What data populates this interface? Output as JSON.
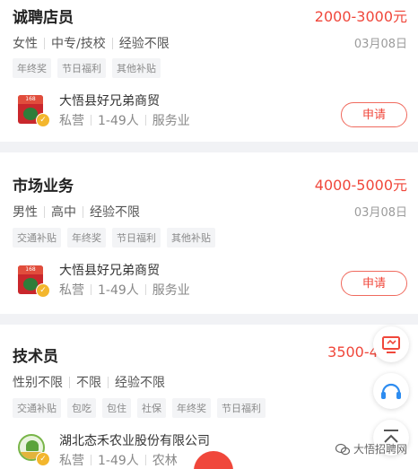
{
  "jobs": [
    {
      "title": "诚聘店员",
      "salary": "2000-3000元",
      "req": [
        "女性",
        "中专/技校",
        "经验不限"
      ],
      "date": "03月08日",
      "tags": [
        "年终奖",
        "节日福利",
        "其他补贴"
      ],
      "company": "大悟县好兄弟商贸",
      "meta": [
        "私营",
        "1-49人",
        "服务业"
      ],
      "apply": "申请"
    },
    {
      "title": "市场业务",
      "salary": "4000-5000元",
      "req": [
        "男性",
        "高中",
        "经验不限"
      ],
      "date": "03月08日",
      "tags": [
        "交通补贴",
        "年终奖",
        "节日福利",
        "其他补贴"
      ],
      "company": "大悟县好兄弟商贸",
      "meta": [
        "私营",
        "1-49人",
        "服务业"
      ],
      "apply": "申请"
    },
    {
      "title": "技术员",
      "salary": "3500-40",
      "req": [
        "性别不限",
        "不限",
        "经验不限"
      ],
      "tags": [
        "交通补贴",
        "包吃",
        "包住",
        "社保",
        "年终奖",
        "节日福利"
      ],
      "company": "湖北态禾农业股份有限公司",
      "meta": [
        "私营",
        "1-49人",
        "农林"
      ]
    }
  ],
  "watermark": "大悟招聘网",
  "icons": {
    "monitor": "monitor-icon",
    "headset": "headset-icon",
    "top": "back-to-top-icon",
    "verified": "verified-badge-icon"
  },
  "colors": {
    "accent": "#f0473b",
    "divider": "#f1f2f5"
  }
}
